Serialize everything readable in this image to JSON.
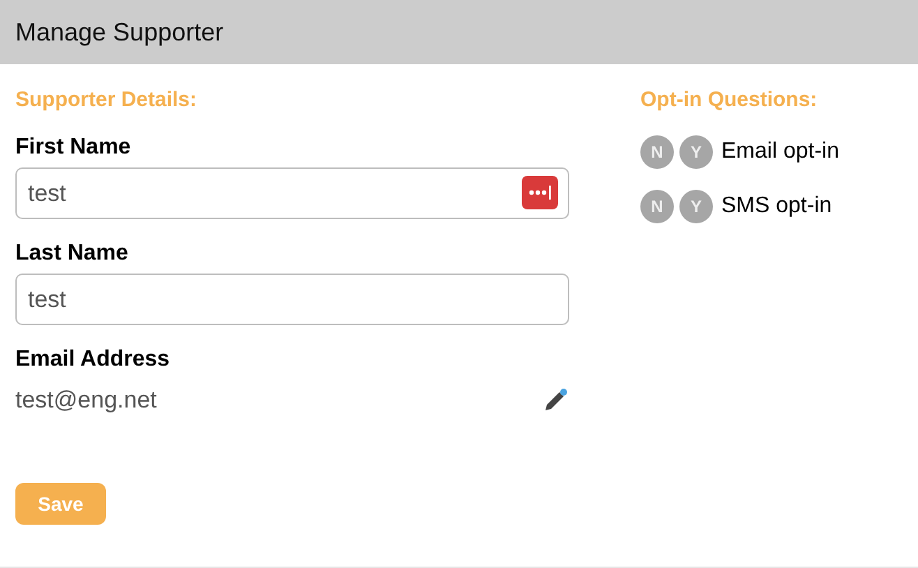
{
  "header": {
    "title": "Manage Supporter"
  },
  "details": {
    "heading": "Supporter Details:",
    "fields": [
      {
        "kind": "input",
        "label": "First Name",
        "value": "test",
        "password_manager": true
      },
      {
        "kind": "input",
        "label": "Last Name",
        "value": "test",
        "password_manager": false
      },
      {
        "kind": "readonly",
        "label": "Email Address",
        "value": "test@eng.net",
        "editable": true
      }
    ]
  },
  "optin": {
    "heading": "Opt-in Questions:",
    "questions": [
      {
        "label": "Email opt-in",
        "options": [
          {
            "text": "N",
            "selected": false
          },
          {
            "text": "Y",
            "selected": false
          }
        ]
      },
      {
        "label": "SMS opt-in",
        "options": [
          {
            "text": "N",
            "selected": false
          },
          {
            "text": "Y",
            "selected": false
          }
        ]
      }
    ]
  },
  "save_button": "Save"
}
